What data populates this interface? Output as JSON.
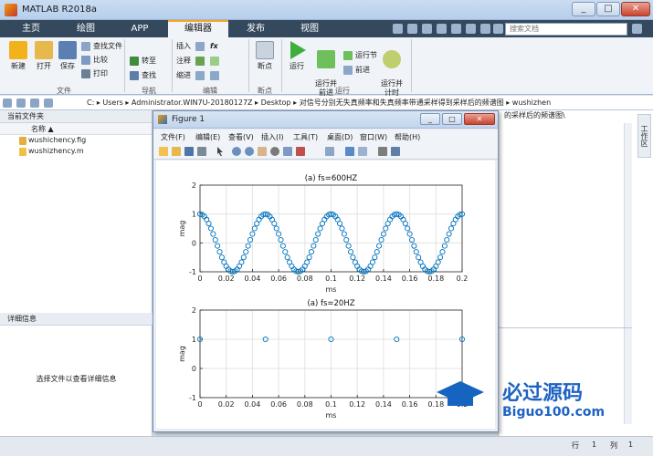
{
  "window": {
    "title": "MATLAB R2018a"
  },
  "ribbon_tabs": [
    "主页",
    "绘图",
    "APP",
    "编辑器",
    "发布",
    "视图"
  ],
  "search": {
    "placeholder": "搜索文档"
  },
  "ribbon": {
    "file": {
      "new": "新建",
      "open": "打开",
      "save": "保存",
      "find_files": "查找文件",
      "compare": "比较",
      "print": "打印",
      "group": "文件"
    },
    "nav": {
      "goto": "转至",
      "find": "查找",
      "group": "导航"
    },
    "edit": {
      "insert": "插入",
      "comment": "注释",
      "indent": "缩进",
      "fx": "fx",
      "group": "编辑"
    },
    "breakpoints": {
      "label": "断点",
      "group": "断点"
    },
    "run": {
      "run": "运行",
      "run_advance": "运行并\n前进",
      "run_section": "运行节",
      "advance": "前进",
      "run_time": "运行并\n计时",
      "group": "运行"
    }
  },
  "path": {
    "crumbs": "C: ▸ Users ▸ Administrator.WIN7U-20180127Z ▸ Desktop ▸ 对信号分别无失真频率和失真频率带通采样得到采样后的频谱图 ▸ wushizhen"
  },
  "current_folder": {
    "title": "当前文件夹",
    "column": "名称 ▲",
    "files": [
      "wushichency.fig",
      "wushizhency.m"
    ]
  },
  "details": {
    "title": "详细信息",
    "hint": "选择文件以查看详细信息"
  },
  "editor_title": "的采样后的频谱图\\",
  "side_tab": "工作区",
  "status": {
    "row_label": "行",
    "row": "1",
    "col_label": "列",
    "col": "1"
  },
  "figure": {
    "title": "Figure 1",
    "menu": [
      "文件(F)",
      "编辑(E)",
      "查看(V)",
      "插入(I)",
      "工具(T)",
      "桌面(D)",
      "窗口(W)",
      "帮助(H)"
    ]
  },
  "watermark": {
    "main": "必过源码",
    "sub": "Biguo100.com"
  },
  "chart_data": [
    {
      "type": "scatter",
      "title": "(a) fs=600HZ",
      "xlabel": "ms",
      "ylabel": "mag",
      "xlim": [
        0,
        0.2
      ],
      "ylim": [
        -1,
        2
      ],
      "xticks": [
        "0",
        "0.02",
        "0.04",
        "0.06",
        "0.08",
        "0.1",
        "0.12",
        "0.14",
        "0.16",
        "0.18",
        "0.2"
      ],
      "yticks": [
        "-1",
        "0",
        "1",
        "2"
      ],
      "signal": "cos(2*pi*20*t)",
      "sample_interval": 0.0016667,
      "marker": "circle",
      "color": "#0072BD",
      "grid": true
    },
    {
      "type": "scatter",
      "title": "(a) fs=20HZ",
      "xlabel": "ms",
      "ylabel": "mag",
      "xlim": [
        0,
        0.2
      ],
      "ylim": [
        -1,
        2
      ],
      "xticks": [
        "0",
        "0.02",
        "0.04",
        "0.06",
        "0.08",
        "0.1",
        "0.12",
        "0.14",
        "0.16",
        "0.18",
        "0.2"
      ],
      "yticks": [
        "-1",
        "0",
        "1",
        "2"
      ],
      "x": [
        0,
        0.05,
        0.1,
        0.15,
        0.2
      ],
      "y": [
        1,
        1,
        1,
        1,
        1
      ],
      "marker": "circle",
      "color": "#0072BD",
      "grid": true
    }
  ]
}
